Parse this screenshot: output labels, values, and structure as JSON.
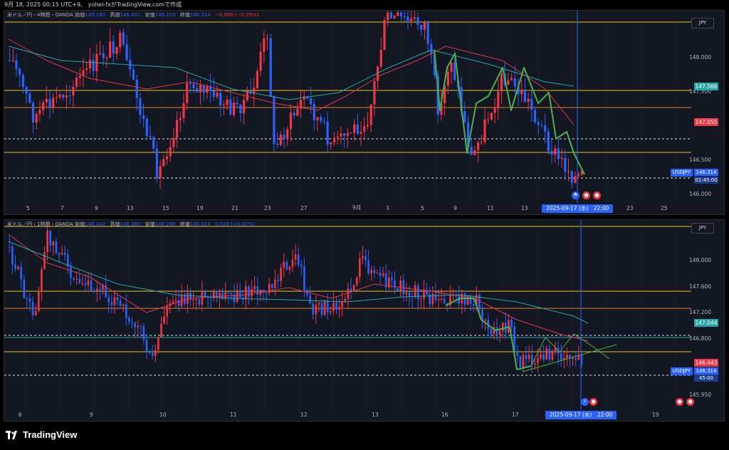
{
  "topline": "9月 18, 2025 00:15 UTC+9、 yohei-fxがTradingView.comで作成",
  "colors": {
    "up": "#f23645",
    "down": "#2962ff",
    "bg": "#131722",
    "ma_red": "#e0354a",
    "ma_teal": "#26a6a6",
    "gold": "#e6c229",
    "orange": "#d9822b",
    "green": "#4caf50",
    "grid": "#1e222d"
  },
  "pane1": {
    "legend_symbol": "米ドル／円・4時間・OANDA",
    "legend_open_lbl": "始値",
    "legend_open": "146.280",
    "legend_high_lbl": "高値",
    "legend_high": "146.401",
    "legend_low_lbl": "安値",
    "legend_low": "146.210",
    "legend_close_lbl": "終値",
    "legend_close": "146.314",
    "legend_change": "−0.066 (−0.05%)",
    "currency": "JPY",
    "y_labels": [
      "148.000",
      "147.500",
      "146.500",
      "146.000"
    ],
    "tag_upper": "147.566",
    "tag_mid": "147.055",
    "symbol": "USDJPY",
    "tag_price": "146.314",
    "tag_countdown": "01:45:00",
    "x_labels": [
      "5",
      "7",
      "9",
      "13",
      "15",
      "19",
      "21",
      "23",
      "27",
      "9月",
      "3",
      "5",
      "9",
      "11",
      "13",
      "23",
      "25"
    ],
    "crosshair_date": "2025-09-17 (水)　22:00"
  },
  "pane2": {
    "legend_symbol": "米ドル／円・1時間・OANDA",
    "legend_open_lbl": "始値",
    "legend_open": "146.242",
    "legend_high_lbl": "高値",
    "legend_high": "146.380",
    "legend_low_lbl": "安値",
    "legend_low": "146.288",
    "legend_close_lbl": "終値",
    "legend_close": "146.314",
    "legend_change": "0.028 (+0.02%)",
    "currency": "JPY",
    "y_labels": [
      "148.000",
      "147.600",
      "147.200",
      "146.800",
      "145.950"
    ],
    "tag_upper": "147.044",
    "tag_mid": "146.443",
    "symbol": "USDJPY",
    "tag_price": "146.314",
    "tag_countdown": "45:00",
    "x_labels": [
      "6",
      "9",
      "10",
      "11",
      "12",
      "13",
      "16",
      "17",
      "19"
    ],
    "crosshair_date": "2025-09-17 (水)　22:00"
  },
  "brand": "TradingView"
}
